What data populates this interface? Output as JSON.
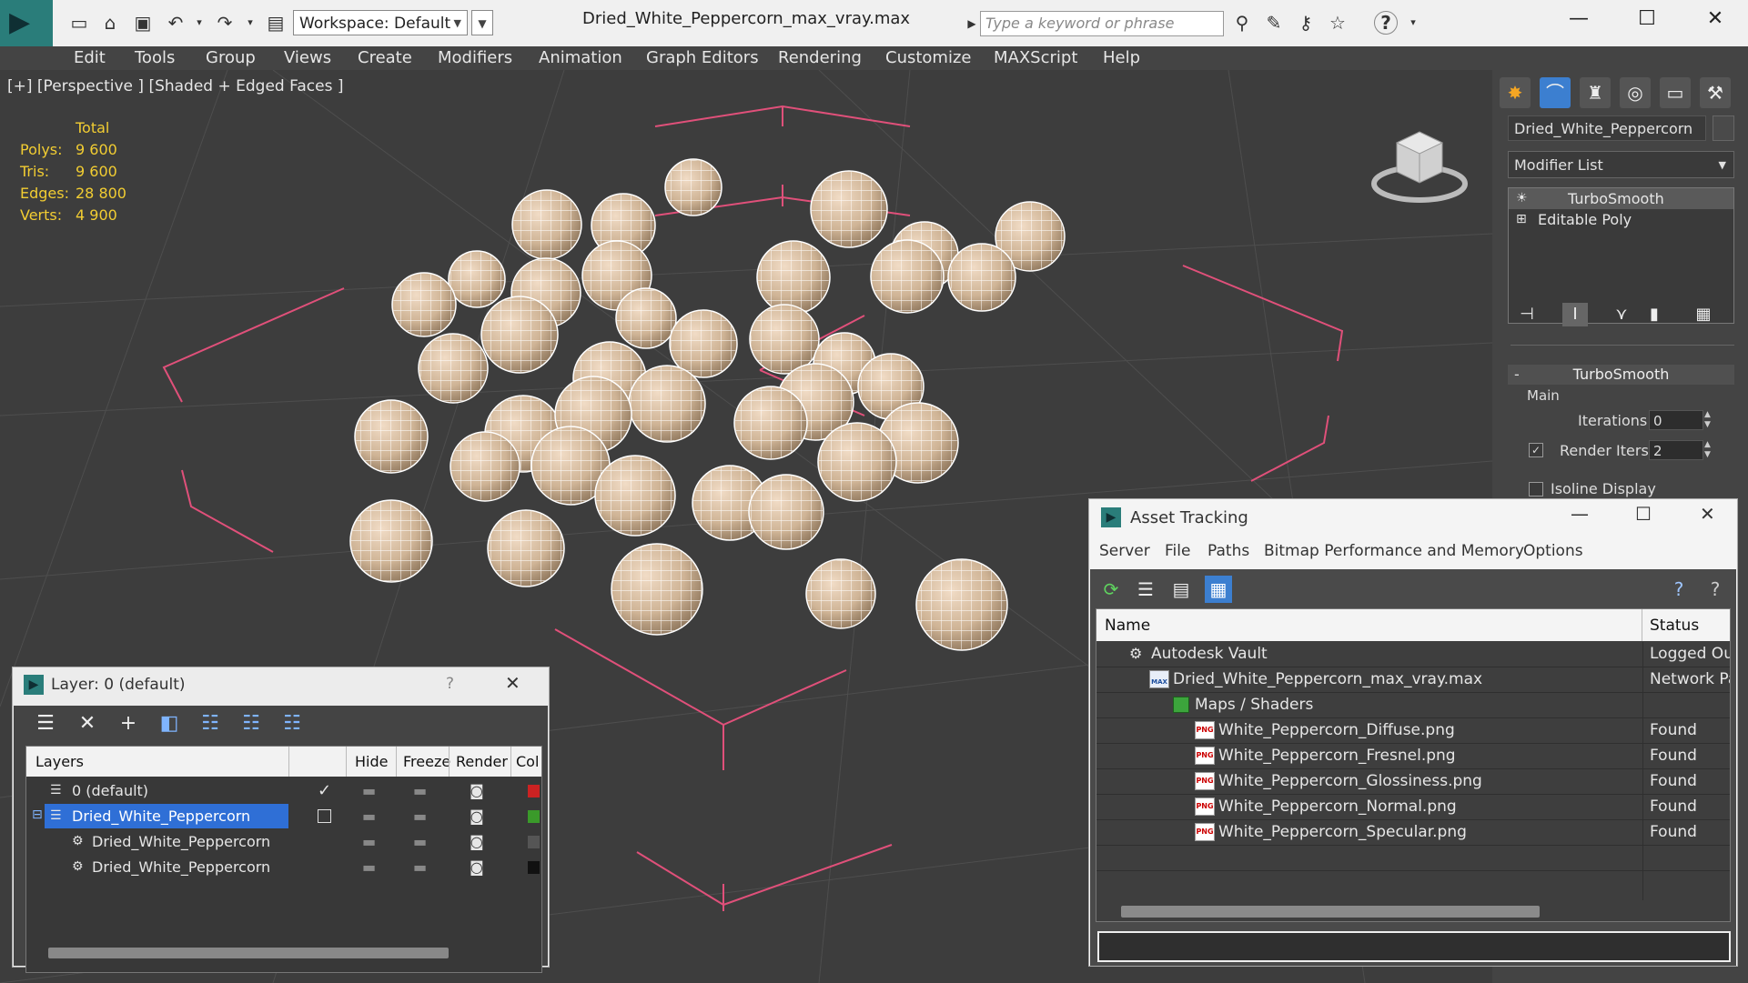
{
  "titlebar": {
    "workspace": "Workspace: Default",
    "document_title": "Dried_White_Peppercorn_max_vray.max",
    "search_placeholder": "Type a keyword or phrase"
  },
  "menu": [
    "Edit",
    "Tools",
    "Group",
    "Views",
    "Create",
    "Modifiers",
    "Animation",
    "Graph Editors",
    "Rendering",
    "Customize",
    "MAXScript",
    "Help"
  ],
  "viewport": {
    "label": "[+] [Perspective ] [Shaded + Edged Faces ]",
    "stats": {
      "header": "Total",
      "rows": [
        {
          "label": "Polys:",
          "value": "9 600"
        },
        {
          "label": "Tris:",
          "value": "9 600"
        },
        {
          "label": "Edges:",
          "value": "28 800"
        },
        {
          "label": "Verts:",
          "value": "4 900"
        }
      ]
    }
  },
  "command_panel": {
    "object_name": "Dried_White_Peppercorn",
    "modifier_list": "Modifier List",
    "stack": [
      "TurboSmooth",
      "Editable Poly"
    ],
    "rollout_title": "TurboSmooth",
    "group_main": "Main",
    "iterations_label": "Iterations:",
    "iterations_value": "0",
    "render_iters_label": "Render Iters:",
    "render_iters_value": "2",
    "isoline_label": "Isoline Display",
    "rollout_minus": "-"
  },
  "layer_dialog": {
    "title": "Layer: 0 (default)",
    "help": "?",
    "columns": [
      "Layers",
      "Hide",
      "Freeze",
      "Render",
      "Col"
    ],
    "rows": [
      {
        "name": "0 (default)",
        "color": "#cc2222",
        "active": true
      },
      {
        "name": "Dried_White_Peppercorn",
        "color": "#3a9a2a",
        "selected": true
      },
      {
        "name": "Dried_White_Peppercorn",
        "color": "#555555"
      },
      {
        "name": "Dried_White_Peppercorn",
        "color": "#111111"
      }
    ]
  },
  "asset_dialog": {
    "title": "Asset Tracking",
    "menu": [
      "Server",
      "File",
      "Paths",
      "Bitmap Performance and Memory",
      "Options"
    ],
    "columns": [
      "Name",
      "Status"
    ],
    "rows": [
      {
        "name": "Autodesk Vault",
        "status": "Logged Out"
      },
      {
        "name": "Dried_White_Peppercorn_max_vray.max",
        "status": "Network Pa"
      },
      {
        "name": "Maps / Shaders",
        "status": ""
      },
      {
        "name": "White_Peppercorn_Diffuse.png",
        "status": "Found"
      },
      {
        "name": "White_Peppercorn_Fresnel.png",
        "status": "Found"
      },
      {
        "name": "White_Peppercorn_Glossiness.png",
        "status": "Found"
      },
      {
        "name": "White_Peppercorn_Normal.png",
        "status": "Found"
      },
      {
        "name": "White_Peppercorn_Specular.png",
        "status": "Found"
      }
    ]
  },
  "colors": {
    "selection": "#2f6fd6",
    "stats_text": "#f2cd32",
    "bbox": "#e0507a",
    "app_teal": "#2a7d7a"
  }
}
